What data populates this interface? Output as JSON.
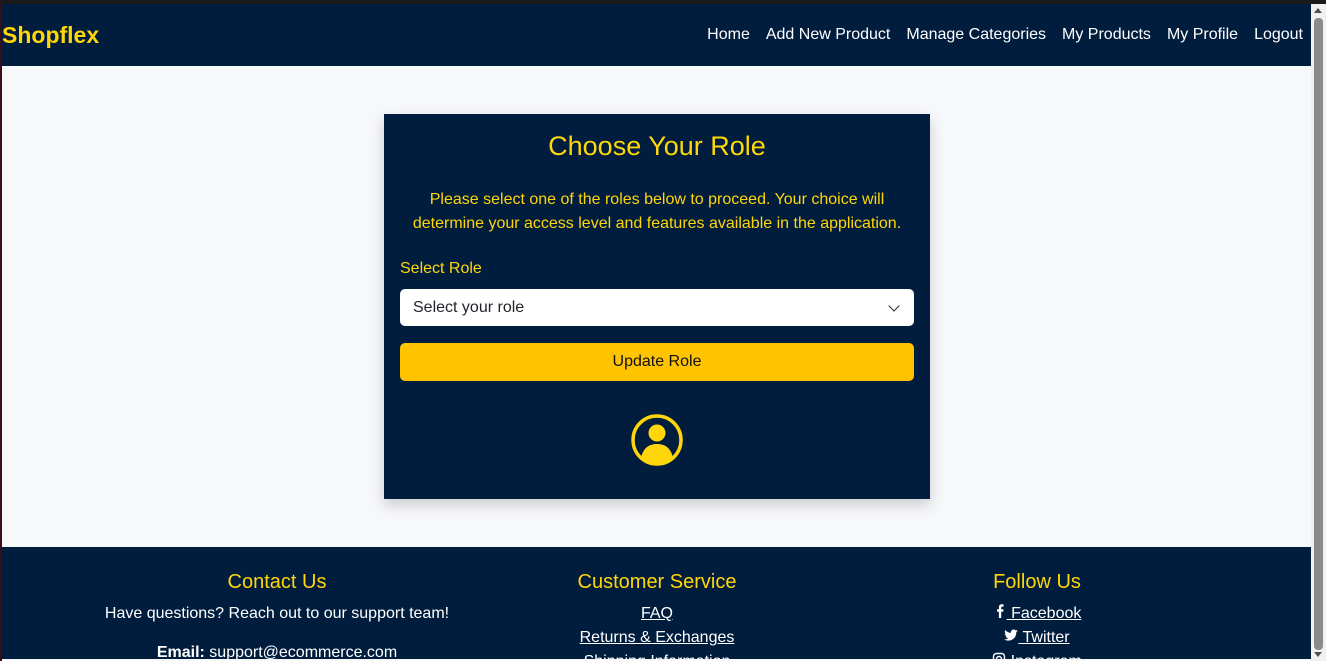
{
  "brand": "Shopflex",
  "nav": {
    "home": "Home",
    "add_product": "Add New Product",
    "manage_categories": "Manage Categories",
    "my_products": "My Products",
    "my_profile": "My Profile",
    "logout": "Logout"
  },
  "card": {
    "title": "Choose Your Role",
    "description": "Please select one of the roles below to proceed. Your choice will determine your access level and features available in the application.",
    "select_label": "Select Role",
    "select_value": "Select your role",
    "button_label": "Update Role",
    "icon": "user-circle-icon"
  },
  "footer": {
    "contact": {
      "title": "Contact Us",
      "text": "Have questions? Reach out to our support team!",
      "email_label": "Email:",
      "email_value": "support@ecommerce.com"
    },
    "service": {
      "title": "Customer Service",
      "links": [
        "FAQ",
        "Returns & Exchanges",
        "Shipping Information"
      ]
    },
    "follow": {
      "title": "Follow Us",
      "links": [
        "Facebook",
        "Twitter",
        "Instagram"
      ]
    }
  },
  "colors": {
    "navy": "#001d3d",
    "accent": "#ffd60a",
    "button": "#ffc300",
    "background": "#f7f8fa"
  }
}
